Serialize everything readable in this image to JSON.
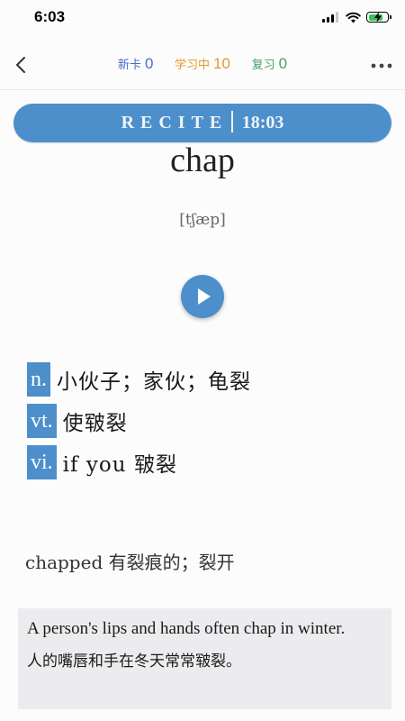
{
  "status_bar": {
    "time": "6:03"
  },
  "nav": {
    "back_icon": "chevron-left-icon",
    "more_icon": "ellipsis-icon",
    "counters": [
      {
        "label": "新卡",
        "value": "0",
        "color": "#4a6cc8"
      },
      {
        "label": "学习中",
        "value": "10",
        "color": "#e39a2b"
      },
      {
        "label": "复习",
        "value": "0",
        "color": "#4aa05a"
      }
    ]
  },
  "banner": {
    "label": "RECITE",
    "time": "18:03",
    "color": "#4c8fcb"
  },
  "card": {
    "word": "chap",
    "phonetic": "[tʃæp]",
    "play_icon": "play-icon",
    "definitions": [
      {
        "pos": "n.",
        "text": "小伙子；家伙；龟裂"
      },
      {
        "pos": "vt.",
        "text": "使皲裂"
      },
      {
        "pos": "vi.",
        "text": "if you 皲裂"
      }
    ],
    "related": "chapped 有裂痕的；裂开",
    "example": {
      "en": "A person's lips and hands often chap in winter.",
      "zh": "人的嘴唇和手在冬天常常皲裂。"
    }
  }
}
